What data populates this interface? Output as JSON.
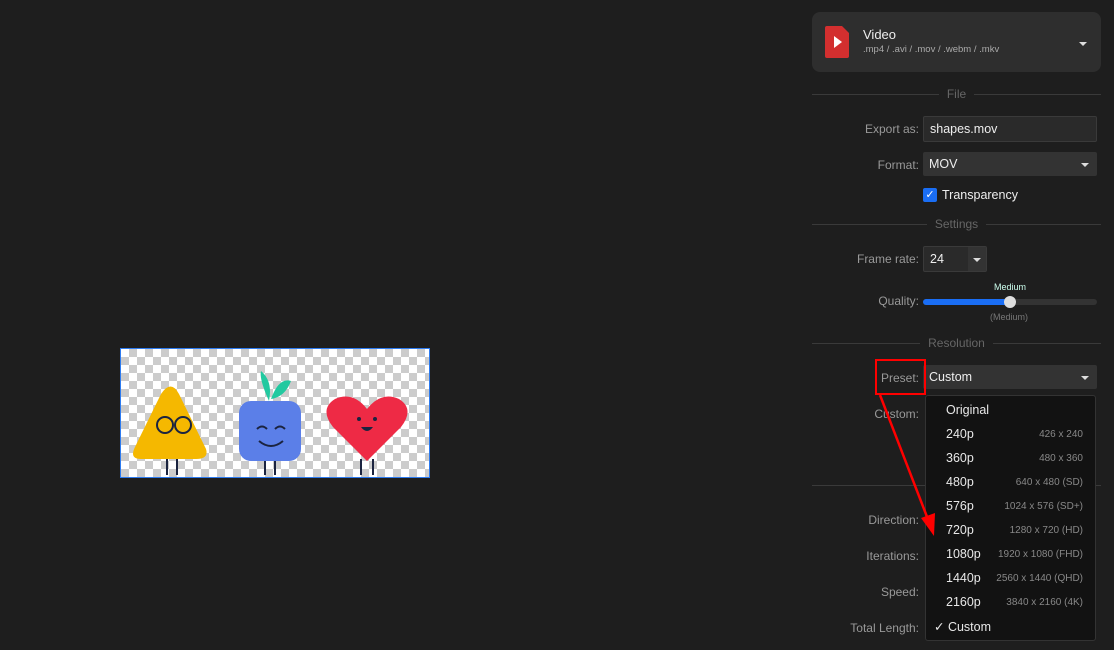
{
  "export_type": {
    "title": "Video",
    "formats": ".mp4 / .avi / .mov / .webm / .mkv",
    "icon": "video-file-icon",
    "accent": "#d32f2f"
  },
  "sections": {
    "file": "File",
    "settings": "Settings",
    "resolution": "Resolution"
  },
  "file": {
    "export_label": "Export as:",
    "export_value": "shapes.mov",
    "format_label": "Format:",
    "format_value": "MOV",
    "transparency_label": "Transparency",
    "transparency_checked": true
  },
  "settings": {
    "frame_rate_label": "Frame rate:",
    "frame_rate_value": "24",
    "quality_label": "Quality:",
    "quality_value": "Medium",
    "quality_sub": "(Medium)",
    "quality_fraction": 0.5
  },
  "resolution": {
    "preset_label": "Preset:",
    "preset_value": "Custom",
    "custom_label": "Custom:"
  },
  "hidden_labels": [
    "Direction:",
    "Iterations:",
    "Speed:",
    "Total Length:"
  ],
  "preset_options": [
    {
      "label": "Original",
      "detail": ""
    },
    {
      "label": "240p",
      "detail": "426 x 240"
    },
    {
      "label": "360p",
      "detail": "480 x 360"
    },
    {
      "label": "480p",
      "detail": "640 x 480 (SD)"
    },
    {
      "label": "576p",
      "detail": "1024 x 576 (SD+)"
    },
    {
      "label": "720p",
      "detail": "1280 x 720 (HD)"
    },
    {
      "label": "1080p",
      "detail": "1920 x 1080 (FHD)"
    },
    {
      "label": "1440p",
      "detail": "2560 x 1440 (QHD)"
    },
    {
      "label": "2160p",
      "detail": "3840 x 2160 (4K)"
    },
    {
      "label": "✓ Custom",
      "detail": ""
    }
  ],
  "colors": {
    "accent": "#1a6ef5",
    "annotation": "#ff0000"
  }
}
